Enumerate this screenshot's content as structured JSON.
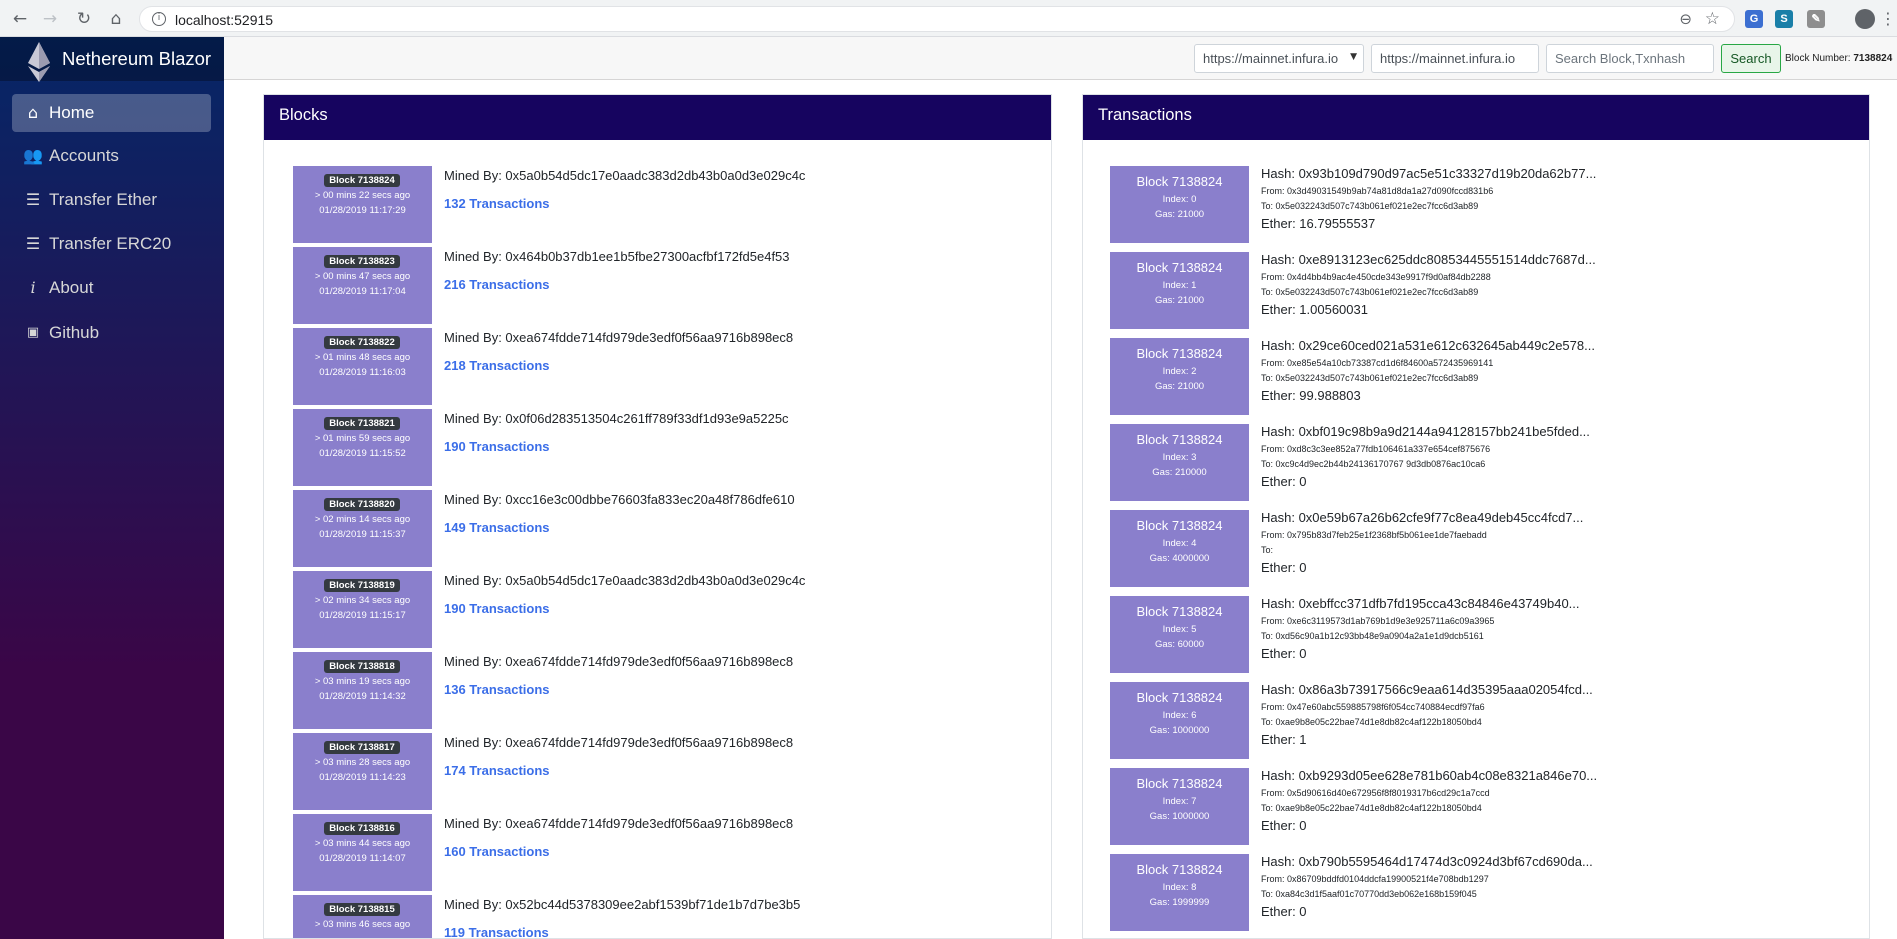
{
  "browser": {
    "url": "localhost:52915"
  },
  "app": {
    "name": "Nethereum Blazor",
    "colors": {
      "card_header": "#16045f",
      "block_box": "#8a7fcc",
      "link": "#3b6ee8"
    }
  },
  "sidebar": {
    "items": [
      {
        "label": "Home",
        "icon": "home-icon",
        "active": true
      },
      {
        "label": "Accounts",
        "icon": "users-icon"
      },
      {
        "label": "Transfer Ether",
        "icon": "list-icon"
      },
      {
        "label": "Transfer ERC20",
        "icon": "list-icon"
      },
      {
        "label": "About",
        "icon": "info-icon"
      },
      {
        "label": "Github",
        "icon": "terminal-icon"
      }
    ]
  },
  "topbar": {
    "rpc_selected": "https://mainnet.infura.io",
    "rpc_input": "https://mainnet.infura.io",
    "search_placeholder": "Search Block,Txnhash",
    "search_label": "Search",
    "block_number_label": "Block Number:",
    "block_number_value": "7138824"
  },
  "blocks": {
    "title": "Blocks",
    "items": [
      {
        "number": "Block 7138824",
        "ago": "> 00 mins 22 secs ago",
        "timestamp": "01/28/2019 11:17:29",
        "miner": "Mined By: 0x5a0b54d5dc17e0aadc383d2db43b0a0d3e029c4c",
        "transactions": "132 Transactions"
      },
      {
        "number": "Block 7138823",
        "ago": "> 00 mins 47 secs ago",
        "timestamp": "01/28/2019 11:17:04",
        "miner": "Mined By: 0x464b0b37db1ee1b5fbe27300acfbf172fd5e4f53",
        "transactions": "216 Transactions"
      },
      {
        "number": "Block 7138822",
        "ago": "> 01 mins 48 secs ago",
        "timestamp": "01/28/2019 11:16:03",
        "miner": "Mined By: 0xea674fdde714fd979de3edf0f56aa9716b898ec8",
        "transactions": "218 Transactions"
      },
      {
        "number": "Block 7138821",
        "ago": "> 01 mins 59 secs ago",
        "timestamp": "01/28/2019 11:15:52",
        "miner": "Mined By: 0x0f06d283513504c261ff789f33df1d93e9a5225c",
        "transactions": "190 Transactions"
      },
      {
        "number": "Block 7138820",
        "ago": "> 02 mins 14 secs ago",
        "timestamp": "01/28/2019 11:15:37",
        "miner": "Mined By: 0xcc16e3c00dbbe76603fa833ec20a48f786dfe610",
        "transactions": "149 Transactions"
      },
      {
        "number": "Block 7138819",
        "ago": "> 02 mins 34 secs ago",
        "timestamp": "01/28/2019 11:15:17",
        "miner": "Mined By: 0x5a0b54d5dc17e0aadc383d2db43b0a0d3e029c4c",
        "transactions": "190 Transactions"
      },
      {
        "number": "Block 7138818",
        "ago": "> 03 mins 19 secs ago",
        "timestamp": "01/28/2019 11:14:32",
        "miner": "Mined By: 0xea674fdde714fd979de3edf0f56aa9716b898ec8",
        "transactions": "136 Transactions"
      },
      {
        "number": "Block 7138817",
        "ago": "> 03 mins 28 secs ago",
        "timestamp": "01/28/2019 11:14:23",
        "miner": "Mined By: 0xea674fdde714fd979de3edf0f56aa9716b898ec8",
        "transactions": "174 Transactions"
      },
      {
        "number": "Block 7138816",
        "ago": "> 03 mins 44 secs ago",
        "timestamp": "01/28/2019 11:14:07",
        "miner": "Mined By: 0xea674fdde714fd979de3edf0f56aa9716b898ec8",
        "transactions": "160 Transactions"
      },
      {
        "number": "Block 7138815",
        "ago": "> 03 mins 46 secs ago",
        "timestamp": "",
        "miner": "Mined By: 0x52bc44d5378309ee2abf1539bf71de1b7d7be3b5",
        "transactions": "119 Transactions"
      }
    ]
  },
  "transactions": {
    "title": "Transactions",
    "items": [
      {
        "block": "Block 7138824",
        "index": "Index: 0",
        "gas": "Gas: 21000",
        "hash": "Hash: 0x93b109d790d97ac5e51c33327d19b20da62b77...",
        "from": "From: 0x3d49031549b9ab74a81d8da1a27d090fccd831b6",
        "to": "To: 0x5e032243d507c743b061ef021e2ec7fcc6d3ab89",
        "ether": "Ether: 16.79555537"
      },
      {
        "block": "Block 7138824",
        "index": "Index: 1",
        "gas": "Gas: 21000",
        "hash": "Hash: 0xe8913123ec625ddc80853445551514ddc7687d...",
        "from": "From: 0x4d4bb4b9ac4e450cde343e9917f9d0af84db2288",
        "to": "To: 0x5e032243d507c743b061ef021e2ec7fcc6d3ab89",
        "ether": "Ether: 1.00560031"
      },
      {
        "block": "Block 7138824",
        "index": "Index: 2",
        "gas": "Gas: 21000",
        "hash": "Hash: 0x29ce60ced021a531e612c632645ab449c2e578...",
        "from": "From: 0xe85e54a10cb73387cd1d6f84600a572435969141",
        "to": "To: 0x5e032243d507c743b061ef021e2ec7fcc6d3ab89",
        "ether": "Ether: 99.988803"
      },
      {
        "block": "Block 7138824",
        "index": "Index: 3",
        "gas": "Gas: 210000",
        "hash": "Hash: 0xbf019c98b9a9d2144a94128157bb241be5fded...",
        "from": "From: 0xd8c3c3ee852a77fdb106461a337e654cef875676",
        "to": "To: 0xc9c4d9ec2b44b24136170767 9d3db0876ac10ca6",
        "ether": "Ether: 0"
      },
      {
        "block": "Block 7138824",
        "index": "Index: 4",
        "gas": "Gas: 4000000",
        "hash": "Hash: 0x0e59b67a26b62cfe9f77c8ea49deb45cc4fcd7...",
        "from": "From: 0x795b83d7feb25e1f2368bf5b061ee1de7faebadd",
        "to": "To:",
        "ether": "Ether: 0"
      },
      {
        "block": "Block 7138824",
        "index": "Index: 5",
        "gas": "Gas: 60000",
        "hash": "Hash: 0xebffcc371dfb7fd195cca43c84846e43749b40...",
        "from": "From: 0xe6c3119573d1ab769b1d9e3e925711a6c09a3965",
        "to": "To: 0xd56c90a1b12c93bb48e9a0904a2a1e1d9dcb5161",
        "ether": "Ether: 0"
      },
      {
        "block": "Block 7138824",
        "index": "Index: 6",
        "gas": "Gas: 1000000",
        "hash": "Hash: 0x86a3b73917566c9eaa614d35395aaa02054fcd...",
        "from": "From: 0x47e60abc559885798f6f054cc740884ecdf97fa6",
        "to": "To: 0xae9b8e05c22bae74d1e8db82c4af122b18050bd4",
        "ether": "Ether: 1"
      },
      {
        "block": "Block 7138824",
        "index": "Index: 7",
        "gas": "Gas: 1000000",
        "hash": "Hash: 0xb9293d05ee628e781b60ab4c08e8321a846e70...",
        "from": "From: 0x5d90616d40e672956f8f8019317b6cd29c1a7ccd",
        "to": "To: 0xae9b8e05c22bae74d1e8db82c4af122b18050bd4",
        "ether": "Ether: 0"
      },
      {
        "block": "Block 7138824",
        "index": "Index: 8",
        "gas": "Gas: 1999999",
        "hash": "Hash: 0xb790b5595464d17474d3c0924d3bf67cd690da...",
        "from": "From: 0x86709bddfd0104ddcfa19900521f4e708bdb1297",
        "to": "To: 0xa84c3d1f5aaf01c70770dd3eb062e168b159f045",
        "ether": "Ether: 0"
      }
    ]
  }
}
